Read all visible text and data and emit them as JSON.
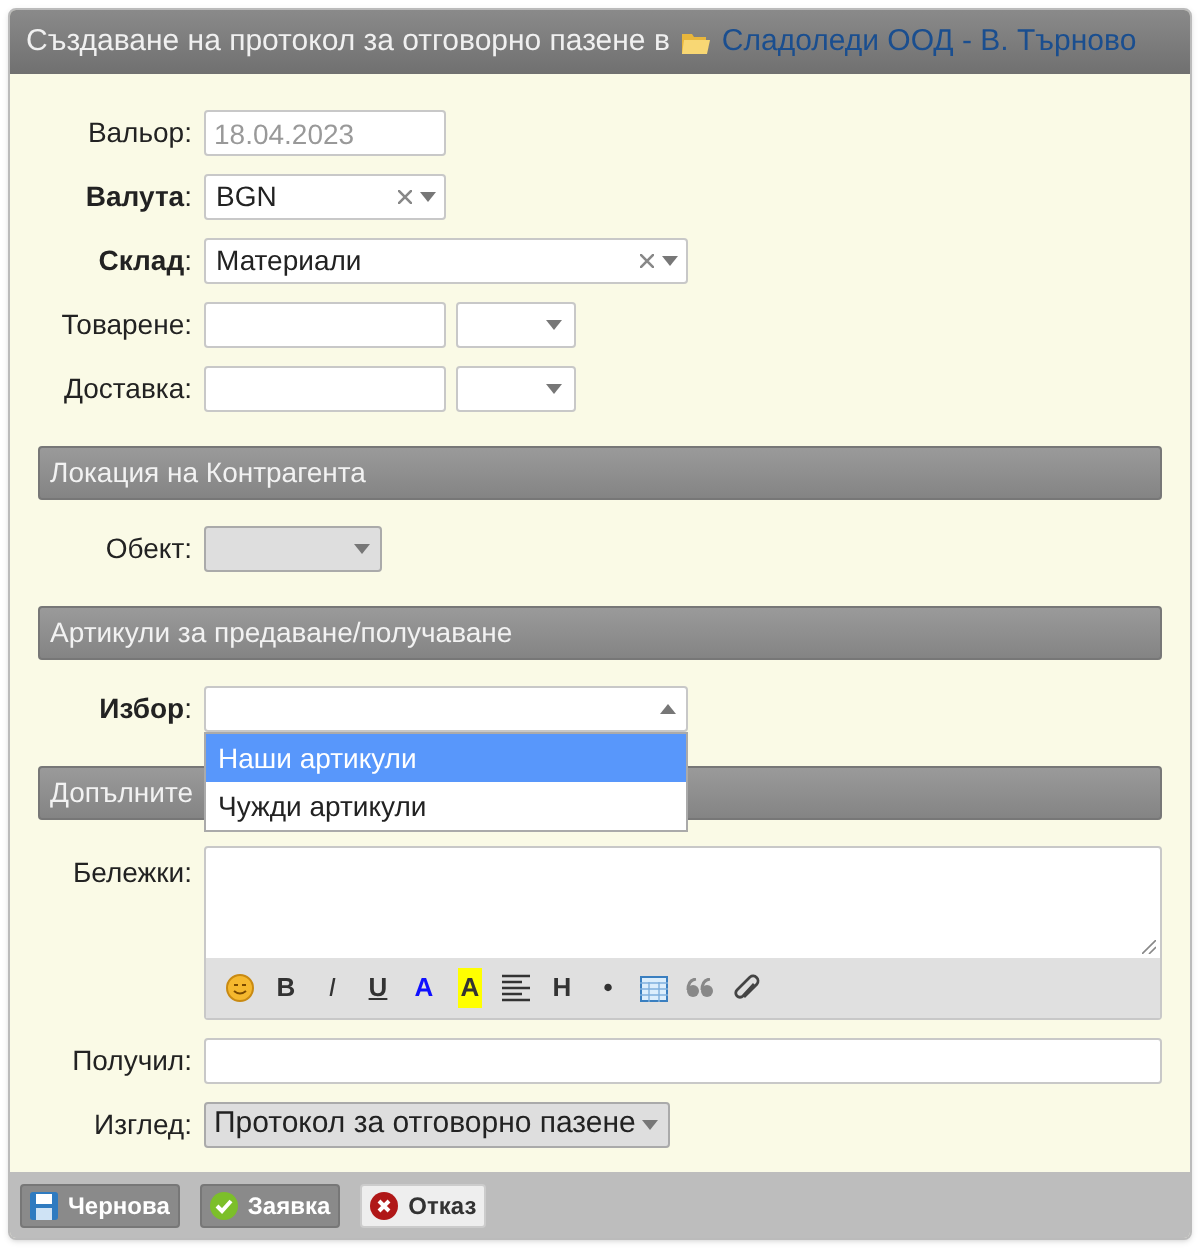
{
  "window": {
    "title": "Създаване на протокол за отговорно пазене в",
    "folder_link": "Сладоледи ООД - В. Търново"
  },
  "sections": [
    {
      "fields": [
        {
          "label": "Вальор:",
          "kind": "date",
          "placeholder": "18.04.2023"
        },
        {
          "label": "**Валута**:",
          "kind": "short_combo",
          "value": "BGN"
        },
        {
          "label": "**Склад**:",
          "kind": "long_combo",
          "value": "Материали"
        },
        {
          "label": "Товарене:",
          "kind": "pair"
        },
        {
          "label": "Доставка:",
          "kind": "pair"
        }
      ]
    },
    {
      "header": "Локация на Контрагента",
      "fields": [
        {
          "label": "Обект:",
          "kind": "small_grey_select"
        }
      ]
    },
    {
      "header": "Артикули за предаване/получаване",
      "fields": [
        {
          "label": "**Избор**:",
          "kind": "open",
          "options": [
            {
              "label": "Наши артикули",
              "selected": true
            },
            {
              "label": "Чужди артикули",
              "selected": false
            }
          ]
        }
      ]
    },
    {
      "header": "Допълните",
      "fields": [
        {
          "label": "Бележки:",
          "kind": "editor",
          "tools": [
            {
              "kind": "emoji"
            },
            {
              "kind": "bold",
              "label": "B"
            },
            {
              "kind": "italic",
              "label": "I"
            },
            {
              "kind": "underline",
              "label": "U"
            },
            {
              "kind": "color",
              "label": "A"
            },
            {
              "kind": "highlight",
              "label": "A"
            },
            {
              "kind": "align"
            },
            {
              "kind": "heading",
              "label": "H"
            },
            {
              "kind": "bullet",
              "label": "•"
            },
            {
              "kind": "table"
            },
            {
              "kind": "quote"
            },
            {
              "kind": "attach"
            }
          ]
        },
        {
          "label": "Получил:",
          "kind": "wide"
        },
        {
          "label": "Изглед:",
          "kind": "grey_select",
          "value": "Протокол за отговорно пазене"
        }
      ]
    }
  ],
  "buttons": [
    {
      "label": "Чернова",
      "kind": "draft"
    },
    {
      "label": "Заявка",
      "kind": "submit"
    },
    {
      "label": "Отказ",
      "kind": "cancel"
    }
  ]
}
